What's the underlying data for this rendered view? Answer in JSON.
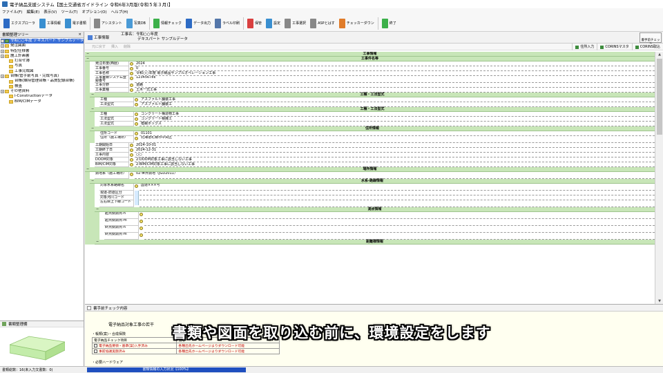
{
  "window": {
    "title": "電子納品支援システム【国土交通省ガイドライン 令和6年3月版(令和５年３月)】"
  },
  "menu": [
    "ファイル(F)",
    "編集(E)",
    "表示(V)",
    "ツール(T)",
    "オプション(O)",
    "ヘルプ(H)"
  ],
  "toolbar": [
    {
      "label": "エクスプローラ",
      "color": "#2d6bc4"
    },
    {
      "label": "工事情報",
      "color": "#3a8fd0"
    },
    {
      "label": "電子書類",
      "color": "#3a8fd0"
    },
    {
      "label": "アシスタント",
      "color": "#888888"
    },
    {
      "label": "写真DB",
      "color": "#4a9ad6"
    },
    {
      "label": "情報チェック",
      "color": "#3cb04a"
    },
    {
      "label": "データ出力",
      "color": "#2d6bc4"
    },
    {
      "label": "ラベル印刷",
      "color": "#5577aa"
    },
    {
      "label": "保管",
      "color": "#d94040"
    },
    {
      "label": "設定",
      "color": "#3a8fd0"
    },
    {
      "label": "工事選択",
      "color": "#888888"
    },
    {
      "label": "ASPとはす",
      "color": "#888888"
    },
    {
      "label": "チェッカーダウン",
      "color": "#e07c2a"
    },
    {
      "label": "終了",
      "color": "#3cb04a"
    }
  ],
  "tree": {
    "title": "書類整理ツリー",
    "items": [
      {
        "label": "令和○○年度 デキスパート サンプルデータ",
        "level": 0,
        "type": "root",
        "selected": true
      },
      {
        "label": "発注図面",
        "level": 0,
        "type": "folder"
      },
      {
        "label": "特記仕様書",
        "level": 0,
        "type": "folder"
      },
      {
        "label": "施工計画書",
        "level": 0,
        "type": "folder"
      },
      {
        "label": "打合せ簿",
        "level": 1,
        "type": "folder"
      },
      {
        "label": "写真",
        "level": 1,
        "type": "folder"
      },
      {
        "label": "工事完成図",
        "level": 1,
        "type": "folder"
      },
      {
        "label": "台帳(管手前写真・完成写真)",
        "level": 0,
        "type": "folder"
      },
      {
        "label": "台帳(維持管理台帳・品質記録台帳)",
        "level": 1,
        "type": "folder"
      },
      {
        "label": "検査",
        "level": 1,
        "type": "folder"
      },
      {
        "label": "その他資料",
        "level": 0,
        "type": "folder"
      },
      {
        "label": "i-Constructionデータ",
        "level": 1,
        "type": "folder"
      },
      {
        "label": "BIM/CIMデータ",
        "level": 1,
        "type": "folder"
      }
    ]
  },
  "bottom_panel": {
    "title": "書類整理棚"
  },
  "status": {
    "left": "書類総数：16(未入力文書数：0)",
    "progress_label": "書類情報の入力状況【100%】",
    "progress": 1.0
  },
  "main": {
    "tab_label": "工事情報",
    "project_name": "工事名：令和○○年度",
    "project_sub": "デキスパート サンプルデータ",
    "check_button": "書手前チェック",
    "tools": [
      "元に戻す",
      "挿入",
      "削除"
    ],
    "tools_right": [
      "住所入力",
      "CORINSマスタ",
      "CORINS取込"
    ]
  },
  "grid": [
    {
      "kind": "section",
      "label": "工事情報",
      "level": 0
    },
    {
      "kind": "section",
      "label": "工事件名等",
      "level": 0
    },
    {
      "kind": "field",
      "label": "発注年度(西暦)",
      "value": "2024",
      "level": 1
    },
    {
      "kind": "field",
      "label": "工事番号",
      "value": "0",
      "level": 1
    },
    {
      "kind": "field",
      "label": "工事名称",
      "value": "令和○○年度 電子納品サンプルオペレーション工事",
      "level": 1
    },
    {
      "kind": "field",
      "label": "工事実績システム登録番号",
      "value": "12345678E",
      "level": 1,
      "tall": true
    },
    {
      "kind": "field",
      "label": "工事分野",
      "value": "道路",
      "level": 1
    },
    {
      "kind": "field",
      "label": "工事業種",
      "value": "土木一式工事",
      "level": 1
    },
    {
      "kind": "section",
      "label": "工種・工法型式",
      "level": 1
    },
    {
      "kind": "field",
      "label": "工種",
      "value": "アスファルト舗装工事",
      "level": 2
    },
    {
      "kind": "field",
      "label": "工法型式",
      "value": "アスファルト舗装工",
      "level": 2
    },
    {
      "kind": "section",
      "label": "工種・工法型式",
      "level": 1
    },
    {
      "kind": "field",
      "label": "工種",
      "value": "コンクリート構造物工事",
      "level": 2
    },
    {
      "kind": "field",
      "label": "工法型式",
      "value": "コンクリート積擁工",
      "level": 2
    },
    {
      "kind": "field",
      "label": "工法型式",
      "value": "植栽ボックス",
      "level": 2
    },
    {
      "kind": "section",
      "label": "住所情報",
      "level": 1
    },
    {
      "kind": "field",
      "label": "住所コード",
      "value": "01101",
      "level": 2
    },
    {
      "kind": "field",
      "label": "住所（施工場所）",
      "value": "北海道札幌市中央区",
      "level": 2,
      "tall": true
    },
    {
      "kind": "field",
      "label": "工期開始日",
      "value": "2024-10-01",
      "level": 1
    },
    {
      "kind": "field",
      "label": "工期終了日",
      "value": "2024-12-31",
      "level": 1
    },
    {
      "kind": "field",
      "label": "工事内容",
      "value": "○○",
      "level": 1
    },
    {
      "kind": "field",
      "label": "DOOM対象",
      "value": "2:DOOM対象工事に該当しない工事",
      "level": 1
    },
    {
      "kind": "field",
      "label": "BIM/CIM対象",
      "value": "2:BIM/CIM対象工事に該当しない工事",
      "level": 1
    },
    {
      "kind": "section",
      "label": "場所情報",
      "level": 0
    },
    {
      "kind": "field",
      "label": "測地系（施工場所）",
      "value": "02:世界測地（JGD2011）",
      "level": 1,
      "tall": true
    },
    {
      "kind": "section",
      "label": "水系-路線情報",
      "level": 1
    },
    {
      "kind": "field",
      "label": "対象水系路線名",
      "value": "国道×××号",
      "level": 2,
      "tall": true
    },
    {
      "kind": "field",
      "label": "現道-旧道区分",
      "value": "",
      "level": 2,
      "blue": true
    },
    {
      "kind": "field",
      "label": "対象河川コード",
      "value": "",
      "level": 2,
      "blue": true
    },
    {
      "kind": "field",
      "label": "左右岸上下線コード",
      "value": "",
      "level": 2,
      "tall": true,
      "blue": true
    },
    {
      "kind": "section",
      "label": "測点情報",
      "level": 2
    },
    {
      "kind": "field",
      "label": "起点側測点-n",
      "value": "",
      "level": 3,
      "tall": true
    },
    {
      "kind": "field",
      "label": "起点側測点-m",
      "value": "",
      "level": 3,
      "tall": true
    },
    {
      "kind": "field",
      "label": "終点側測点-n",
      "value": "",
      "level": 3,
      "tall": true
    },
    {
      "kind": "field",
      "label": "終点側測点-m",
      "value": "",
      "level": 3,
      "tall": true
    },
    {
      "kind": "section",
      "label": "距離標情報",
      "level": 2
    }
  ],
  "check_panel": {
    "title": "書手前チェック内容",
    "heading": "電子納品対象工事の若干",
    "line1": "・帳類(案)・合成保険",
    "table_header": [
      "電子納品チェック項目",
      "備考"
    ],
    "rows": [
      {
        "item": "電子納品要領・基準(案)入手済み",
        "note": "各種出先ホームページよりダウンロード可能"
      },
      {
        "item": "事前協議実施済み",
        "note": "各種出先ホームページよりダウンロード可能"
      }
    ],
    "line2": "・必要ハードウェア"
  },
  "caption": "書類や図面を取り込む前に、環境設定をします"
}
